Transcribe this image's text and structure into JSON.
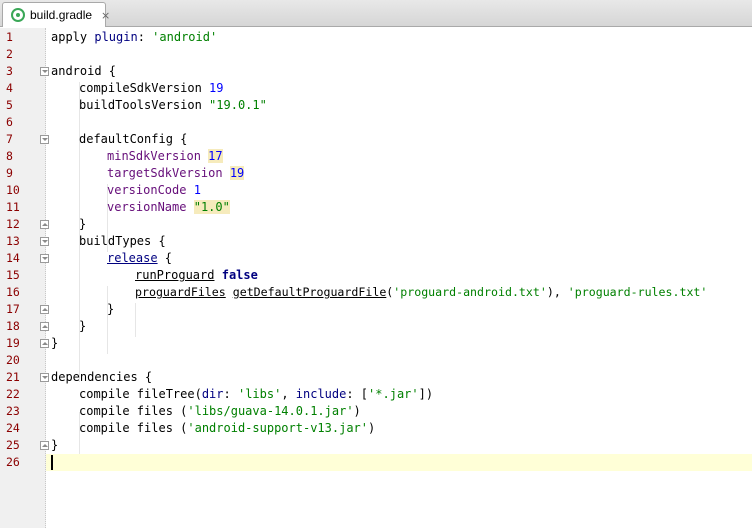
{
  "tab": {
    "label": "build.gradle",
    "close": "×",
    "icon": "gradle-icon"
  },
  "editor": {
    "lines": [
      "1",
      "2",
      "3",
      "4",
      "5",
      "6",
      "7",
      "8",
      "9",
      "10",
      "11",
      "12",
      "13",
      "14",
      "15",
      "16",
      "17",
      "18",
      "19",
      "20",
      "21",
      "22",
      "23",
      "24",
      "25",
      "26"
    ],
    "code": {
      "l1_a": "apply ",
      "l1_b": "plugin",
      "l1_c": ": ",
      "l1_d": "'android'",
      "l3": "android {",
      "l4_a": "compileSdkVersion ",
      "l4_b": "19",
      "l5_a": "buildToolsVersion ",
      "l5_b": "\"19.0.1\"",
      "l7": "defaultConfig {",
      "l8_a": "minSdkVersion",
      "l8_b": " ",
      "l8_c": "17",
      "l9_a": "targetSdkVersion",
      "l9_b": " ",
      "l9_c": "19",
      "l10_a": "versionCode",
      "l10_b": " ",
      "l10_c": "1",
      "l11_a": "versionName",
      "l11_b": " ",
      "l11_c": "\"1.0\"",
      "l12": "}",
      "l13": "buildTypes {",
      "l14_a": "release",
      "l14_b": " {",
      "l15_a": "runProguard",
      "l15_b": " ",
      "l15_c": "false",
      "l16_a": "proguardFiles",
      "l16_b": " ",
      "l16_c": "getDefaultProguardFile",
      "l16_d": "(",
      "l16_e": "'proguard-android.txt'",
      "l16_f": "), ",
      "l16_g": "'proguard-rules.txt'",
      "l17": "}",
      "l18": "}",
      "l19": "}",
      "l21": "dependencies {",
      "l22_a": "compile fileTree(",
      "l22_b": "dir",
      "l22_c": ": ",
      "l22_d": "'libs'",
      "l22_e": ", ",
      "l22_f": "include",
      "l22_g": ": [",
      "l22_h": "'*.jar'",
      "l22_i": "])",
      "l23_a": "compile files (",
      "l23_b": "'libs/guava-14.0.1.jar'",
      "l23_c": ")",
      "l24_a": "compile files (",
      "l24_b": "'android-support-v13.jar'",
      "l24_c": ")",
      "l25": "}"
    }
  },
  "colors": {
    "line_number": "#8b0000",
    "string": "#008000",
    "number": "#0000ff",
    "property": "#660e7a",
    "keyword": "#000080",
    "current_line": "#ffffd7",
    "highlight": "#f6ebbc"
  }
}
